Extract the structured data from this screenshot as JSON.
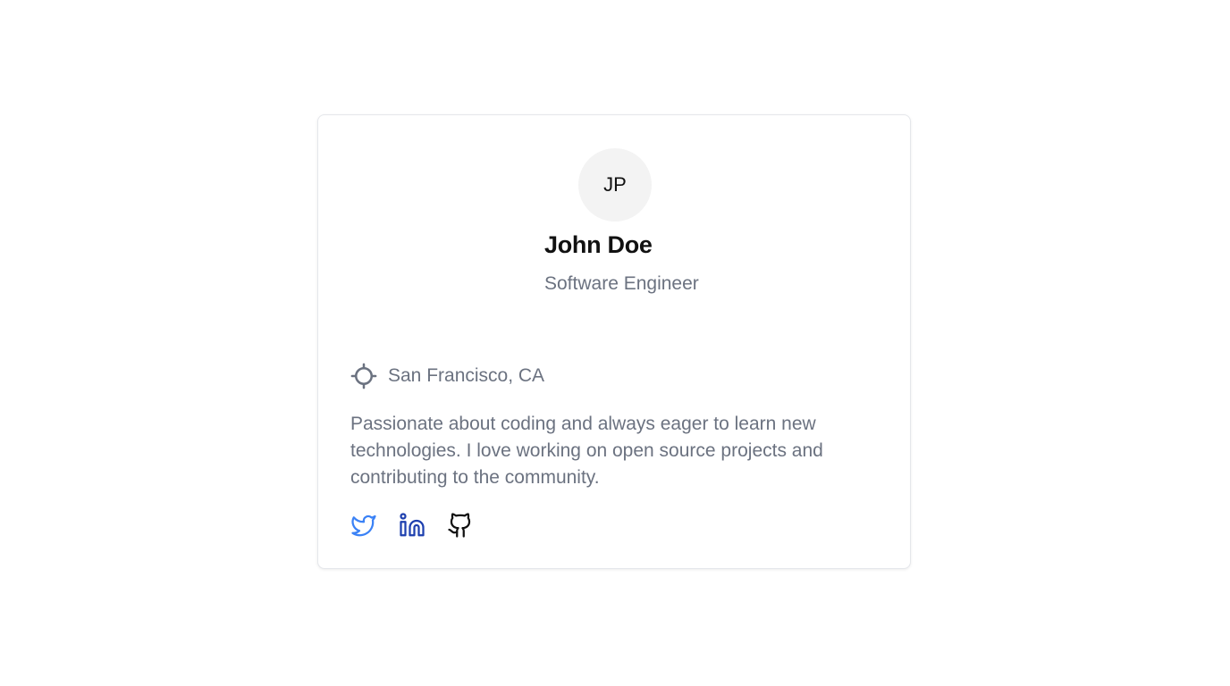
{
  "profile": {
    "initials": "JP",
    "name": "John Doe",
    "title": "Software Engineer",
    "location": "San Francisco, CA",
    "bio": "Passionate about coding and always eager to learn new technologies. I love working on open source projects and contributing to the community."
  },
  "icons": {
    "location": "crosshair-icon",
    "twitter": "twitter-icon",
    "linkedin": "linkedin-icon",
    "github": "github-icon"
  },
  "colors": {
    "twitter": "#3b82f6",
    "linkedin": "#1e40af",
    "github": "#111111",
    "muted_text": "#6b7280"
  }
}
